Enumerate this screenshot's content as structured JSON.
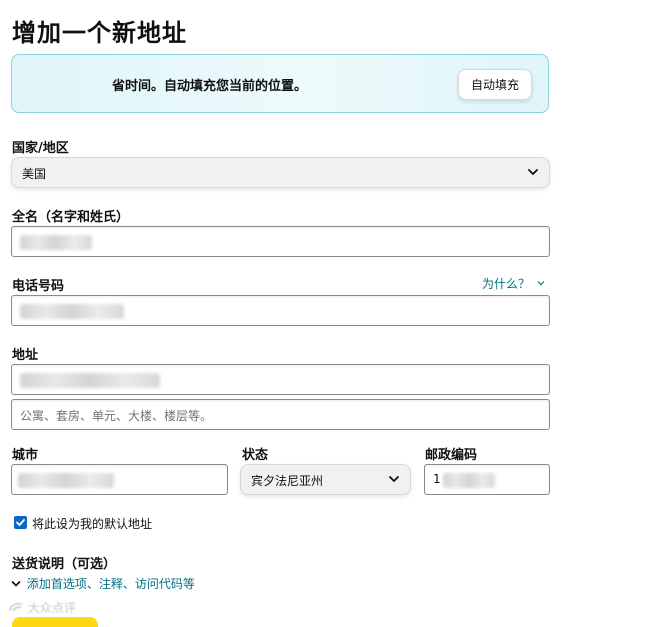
{
  "page": {
    "title": "增加一个新地址"
  },
  "banner": {
    "text": "省时间。自动填充您当前的位置。",
    "button_label": "自动填充"
  },
  "form": {
    "country": {
      "label": "国家/地区",
      "value": "美国",
      "icon": "chevron-down-icon"
    },
    "full_name": {
      "label": "全名（名字和姓氏）"
    },
    "phone": {
      "label": "电话号码",
      "help_link": "为什么？"
    },
    "address": {
      "label": "地址",
      "line2_placeholder": "公寓、套房、单元、大楼、楼层等。"
    },
    "city": {
      "label": "城市"
    },
    "state": {
      "label": "状态",
      "value": "宾夕法尼亚州",
      "icon": "chevron-down-icon"
    },
    "zip": {
      "label": "邮政编码",
      "visible_prefix": "1"
    },
    "default_checkbox": {
      "label": "将此设为我的默认地址",
      "checked": true
    },
    "delivery": {
      "label": "送货说明（可选）",
      "link": "添加首选项、注释、访问代码等"
    }
  },
  "watermark": {
    "text": "大众点评"
  },
  "colors": {
    "link": "#007185",
    "checkbox": "#0a68c9",
    "banner_border": "#8fd3d8",
    "primary_button": "#ffd814"
  }
}
